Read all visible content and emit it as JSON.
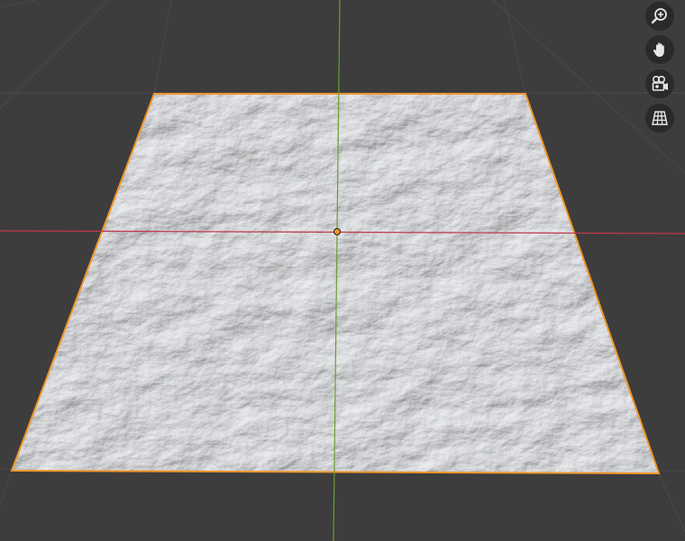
{
  "viewport": {
    "background_color": "#3d3d3d",
    "grid_line_color": "#4a4a4a",
    "x_axis_color": "#c0394b",
    "y_axis_color": "#6b9e2e",
    "selection_outline_color": "#f0962a",
    "origin_color": "#f0962a",
    "mesh": {
      "object": "terrain-plane",
      "selected": true,
      "base_color": "#c9ccd1",
      "highlight_color": "#eceef1",
      "shadow_color": "#8d9299"
    }
  },
  "navigation_gizmo": {
    "buttons": [
      {
        "id": "zoom",
        "icon": "zoom-in-icon"
      },
      {
        "id": "pan",
        "icon": "hand-icon"
      },
      {
        "id": "camera",
        "icon": "camera-icon"
      },
      {
        "id": "perspective",
        "icon": "grid-perspective-icon"
      }
    ]
  }
}
